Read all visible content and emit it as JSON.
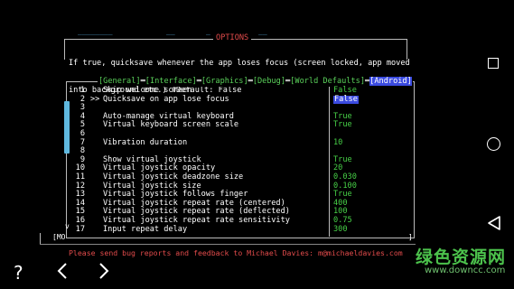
{
  "top_fragments": [
    "________",
    "__",
    "_",
    "__"
  ],
  "options": {
    "title": "OPTIONS",
    "description_lines": [
      "If true, quicksave whenever the app loses focus (screen locked, app moved",
      "into background etc.) #Default: False"
    ]
  },
  "tabs": [
    {
      "label": "[General]"
    },
    {
      "label": "[Interface]"
    },
    {
      "label": "[Graphics]"
    },
    {
      "label": "[Debug]"
    },
    {
      "label": "[World Defaults]"
    },
    {
      "label": "[Android]"
    }
  ],
  "tab_separator": "═",
  "rows": [
    {
      "num": "1",
      "pointer": "",
      "label": "Skip welcome screen",
      "value": "False",
      "selected": false
    },
    {
      "num": "2",
      "pointer": ">>",
      "label": "Quicksave on app lose focus",
      "value": "False",
      "selected": true
    },
    {
      "num": "3",
      "pointer": "",
      "label": "",
      "value": "",
      "selected": false
    },
    {
      "num": "4",
      "pointer": "",
      "label": "Auto-manage virtual keyboard",
      "value": "True",
      "selected": false
    },
    {
      "num": "5",
      "pointer": "",
      "label": "Virtual keyboard screen scale",
      "value": "True",
      "selected": false
    },
    {
      "num": "6",
      "pointer": "",
      "label": "",
      "value": "",
      "selected": false
    },
    {
      "num": "7",
      "pointer": "",
      "label": "Vibration duration",
      "value": "10",
      "selected": false
    },
    {
      "num": "8",
      "pointer": "",
      "label": "",
      "value": "",
      "selected": false
    },
    {
      "num": "9",
      "pointer": "",
      "label": "Show virtual joystick",
      "value": "True",
      "selected": false
    },
    {
      "num": "10",
      "pointer": "",
      "label": "Virtual joystick opacity",
      "value": "20",
      "selected": false
    },
    {
      "num": "11",
      "pointer": "",
      "label": "Virtual joystick deadzone size",
      "value": "0.030",
      "selected": false
    },
    {
      "num": "12",
      "pointer": "",
      "label": "Virtual joystick size",
      "value": "0.100",
      "selected": false
    },
    {
      "num": "13",
      "pointer": "",
      "label": "Virtual joystick follows finger",
      "value": "True",
      "selected": false
    },
    {
      "num": "14",
      "pointer": "",
      "label": "Virtual joystick repeat rate (centered)",
      "value": "400",
      "selected": false
    },
    {
      "num": "15",
      "pointer": "",
      "label": "Virtual joystick repeat rate (deflected)",
      "value": "100",
      "selected": false
    },
    {
      "num": "16",
      "pointer": "",
      "label": "Virtual joystick repeat rate sensitivity",
      "value": "0.75",
      "selected": false
    },
    {
      "num": "17",
      "pointer": "",
      "label": "Input repeat delay",
      "value": "300",
      "selected": false
    }
  ],
  "scroll_indicator": "v",
  "bottom": {
    "left_label": "[MO",
    "right_mark": "]"
  },
  "footer_message": "Please send bug reports and feedback to Michael Davies: m@michaeldavies.com",
  "nav": {
    "help": "?",
    "prev": "<",
    "next": ">"
  },
  "watermark": {
    "text": "绿色资源网",
    "url": "www.downcc.com"
  },
  "colors": {
    "accent_blue": "#3b4be0",
    "value_green": "#47d047",
    "title_red": "#e24b4b",
    "scroll_cyan": "#5fb8df"
  }
}
